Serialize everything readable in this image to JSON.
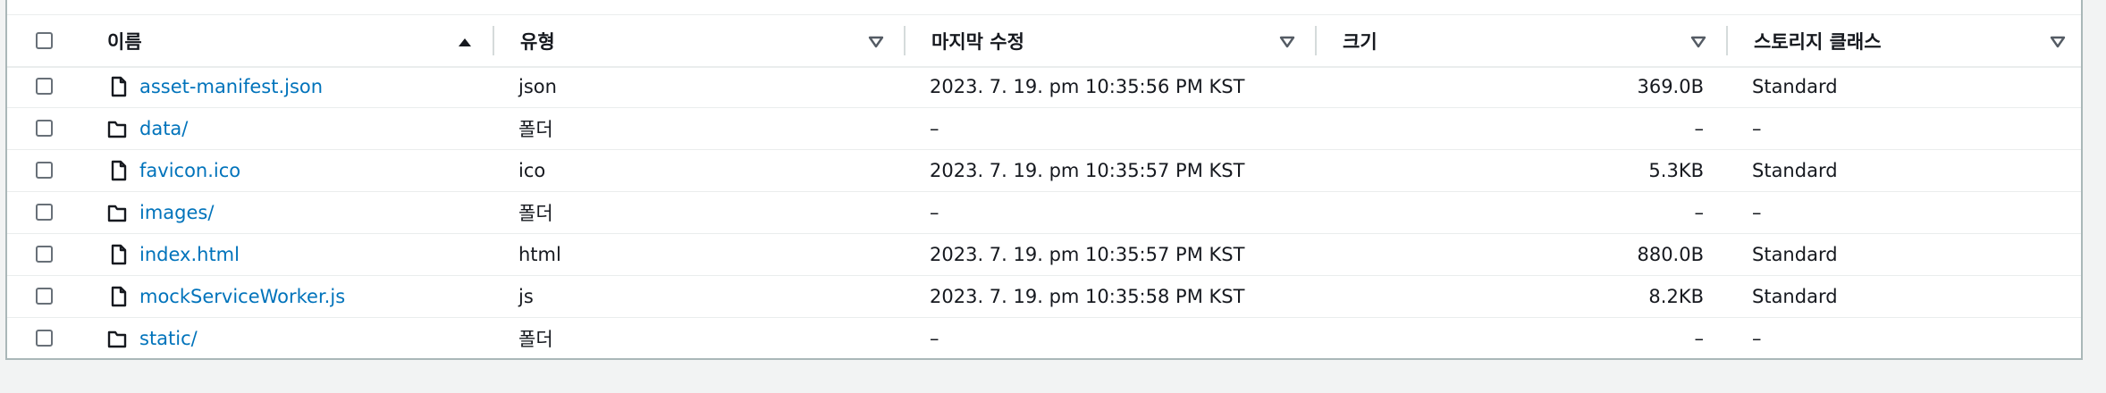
{
  "columns": {
    "name": "이름",
    "type": "유형",
    "modified": "마지막 수정",
    "size": "크기",
    "storage_class": "스토리지 클래스"
  },
  "rows": [
    {
      "name": "asset-manifest.json",
      "kind": "file",
      "type": "json",
      "modified": "2023. 7. 19. pm 10:35:56 PM KST",
      "size": "369.0B",
      "storage_class": "Standard"
    },
    {
      "name": "data/",
      "kind": "folder",
      "type": "폴더",
      "modified": "–",
      "size": "–",
      "storage_class": "–"
    },
    {
      "name": "favicon.ico",
      "kind": "file",
      "type": "ico",
      "modified": "2023. 7. 19. pm 10:35:57 PM KST",
      "size": "5.3KB",
      "storage_class": "Standard"
    },
    {
      "name": "images/",
      "kind": "folder",
      "type": "폴더",
      "modified": "–",
      "size": "–",
      "storage_class": "–"
    },
    {
      "name": "index.html",
      "kind": "file",
      "type": "html",
      "modified": "2023. 7. 19. pm 10:35:57 PM KST",
      "size": "880.0B",
      "storage_class": "Standard"
    },
    {
      "name": "mockServiceWorker.js",
      "kind": "file",
      "type": "js",
      "modified": "2023. 7. 19. pm 10:35:58 PM KST",
      "size": "8.2KB",
      "storage_class": "Standard"
    },
    {
      "name": "static/",
      "kind": "folder",
      "type": "폴더",
      "modified": "–",
      "size": "–",
      "storage_class": "–"
    }
  ],
  "icons": {
    "file": "file-icon",
    "folder": "folder-icon",
    "sort_asc": "sort-ascending-icon",
    "sort": "sort-descending-icon"
  },
  "colors": {
    "link": "#0073bb",
    "text": "#16191f",
    "border": "#eaeded",
    "background": "#f2f3f3"
  }
}
